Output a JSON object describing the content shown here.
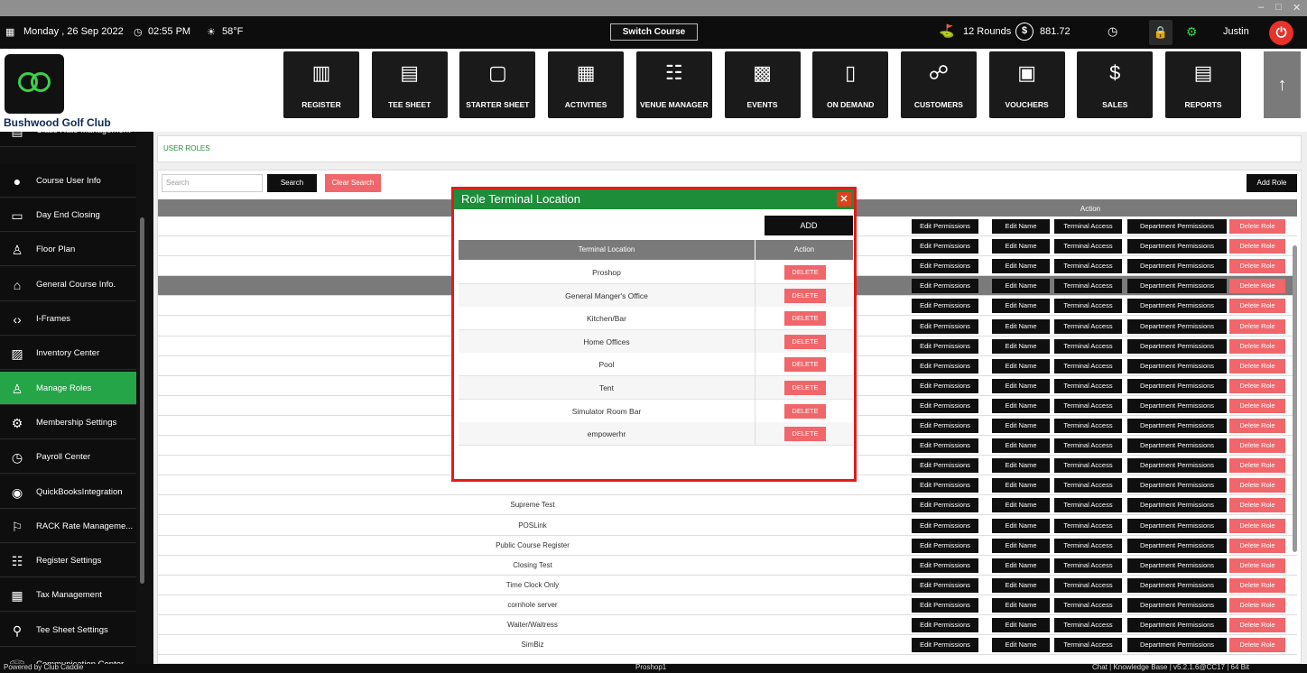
{
  "window": {
    "minimize": "–",
    "maximize": "□",
    "close": "✕"
  },
  "topbar": {
    "date": "Monday , 26 Sep 2022",
    "time": "02:55 PM",
    "weather": "58°F",
    "switch_course": "Switch Course",
    "rounds": "12 Rounds",
    "balance": "881.72",
    "user": "Justin"
  },
  "header": {
    "club_name": "Bushwood Golf Club",
    "modules": [
      {
        "label": "REGISTER",
        "icon": "barcode-scanner-icon"
      },
      {
        "label": "TEE SHEET",
        "icon": "tee-sheet-icon"
      },
      {
        "label": "STARTER SHEET",
        "icon": "tablet-icon"
      },
      {
        "label": "ACTIVITIES",
        "icon": "calendar-icon"
      },
      {
        "label": "VENUE MANAGER",
        "icon": "venue-icon"
      },
      {
        "label": "EVENTS",
        "icon": "events-calendar-icon"
      },
      {
        "label": "ON DEMAND",
        "icon": "phone-icon"
      },
      {
        "label": "CUSTOMERS",
        "icon": "customers-icon"
      },
      {
        "label": "VOUCHERS",
        "icon": "voucher-icon"
      },
      {
        "label": "SALES",
        "icon": "sales-icon"
      },
      {
        "label": "REPORTS",
        "icon": "reports-icon"
      }
    ]
  },
  "sidebar": {
    "items": [
      {
        "label": "Class Rate Management",
        "icon": "rate-icon"
      },
      {
        "label": "Course User Info",
        "icon": "user-icon"
      },
      {
        "label": "Day End Closing",
        "icon": "register-icon"
      },
      {
        "label": "Floor Plan",
        "icon": "floor-plan-icon"
      },
      {
        "label": "General Course Info.",
        "icon": "home-icon"
      },
      {
        "label": "I-Frames",
        "icon": "code-icon"
      },
      {
        "label": "Inventory Center",
        "icon": "inventory-icon"
      },
      {
        "label": "Manage Roles",
        "icon": "roles-icon"
      },
      {
        "label": "Membership Settings",
        "icon": "settings-icon"
      },
      {
        "label": "Payroll Center",
        "icon": "clock-icon"
      },
      {
        "label": "QuickBooksIntegration",
        "icon": "quickbooks-icon"
      },
      {
        "label": "RACK Rate Manageme...",
        "icon": "rack-rate-icon"
      },
      {
        "label": "Register Settings",
        "icon": "sliders-icon"
      },
      {
        "label": "Tax Management",
        "icon": "tax-icon"
      },
      {
        "label": "Tee Sheet Settings",
        "icon": "tee-icon"
      },
      {
        "label": "Communication Center",
        "icon": "communication-icon"
      }
    ]
  },
  "main": {
    "breadcrumb": "USER ROLES",
    "search_placeholder": "Search",
    "search_button": "Search",
    "clear_button": "Clear Search",
    "add_role": "Add Role",
    "action_header": "Action",
    "action_labels": {
      "edit_permissions": "Edit Permissions",
      "edit_name": "Edit Name",
      "terminal_access": "Terminal Access",
      "department_permissions": "Department Permissions",
      "delete_role": "Delete Role"
    },
    "roles": [
      "",
      "",
      "",
      "",
      "",
      "",
      "",
      "",
      "",
      "",
      "",
      "",
      "",
      "",
      "Supreme Test",
      "POSLink",
      "Public Course Register",
      "Closing Test",
      "Time Clock Only",
      "cornhole server",
      "Waiter/Waitress",
      "SimBiz"
    ]
  },
  "modal": {
    "title": "Role Terminal Location",
    "add_button": "ADD",
    "col_location": "Terminal Location",
    "col_action": "Action",
    "delete_label": "DELETE",
    "locations": [
      "Proshop",
      "General Manger's Office",
      "Kitchen/Bar",
      "Home Offices",
      "Pool",
      "Tent",
      "Simulator Room Bar",
      "empowerhr"
    ]
  },
  "footer": {
    "powered": "Powered by Club Caddie",
    "terminal": "Proshop1",
    "links": "Chat  |  Knowledge Base  |  v5.2.1.6@CC17  |  64 Bit"
  }
}
